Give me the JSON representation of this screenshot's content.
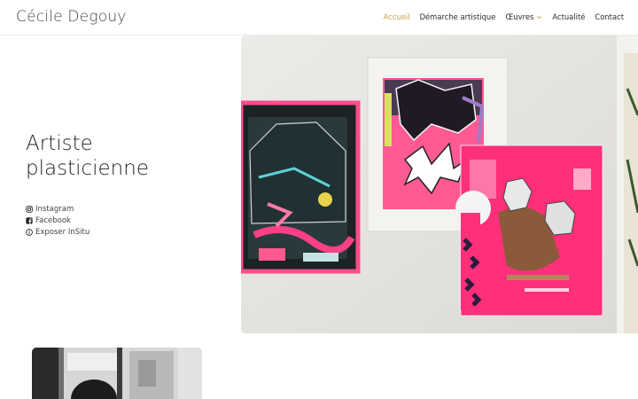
{
  "site": {
    "title": "Cécile Degouy"
  },
  "nav": {
    "items": [
      {
        "label": "Accueil",
        "active": true
      },
      {
        "label": "Démarche artistique",
        "active": false
      },
      {
        "label": "Œuvres",
        "active": false,
        "dropdown": true
      },
      {
        "label": "Actualité",
        "active": false
      },
      {
        "label": "Contact",
        "active": false
      }
    ],
    "active_color": "#c8a252"
  },
  "hero": {
    "title_line1": "Artiste",
    "title_line2": "plasticienne",
    "image_icon": "artwork-photo"
  },
  "social": [
    {
      "label": "Instagram",
      "icon": "instagram-icon"
    },
    {
      "label": "Facebook",
      "icon": "facebook-icon"
    },
    {
      "label": "Exposer InSitu",
      "icon": "info-icon"
    }
  ],
  "second_image": {
    "icon": "artist-photo"
  }
}
